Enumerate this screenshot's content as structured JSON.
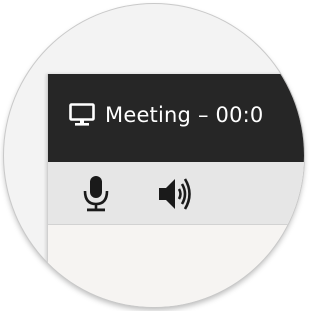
{
  "window": {
    "title": "Meeting – 00:0",
    "title_icon": "monitor-icon"
  },
  "toolbar": {
    "buttons": [
      {
        "icon": "microphone-icon"
      },
      {
        "icon": "speaker-icon"
      }
    ]
  },
  "colors": {
    "titlebar": "#262626",
    "toolbar": "#e6e6e6",
    "content": "#f6f4f2",
    "icon": "#1a1a1a",
    "title_text": "#ffffff"
  }
}
